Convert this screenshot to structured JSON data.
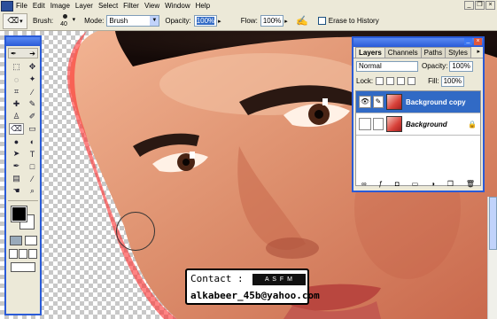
{
  "menu": [
    "File",
    "Edit",
    "Image",
    "Layer",
    "Select",
    "Filter",
    "View",
    "Window",
    "Help"
  ],
  "options": {
    "brush_label": "Brush:",
    "brush_size": "40",
    "mode_label": "Mode:",
    "mode_value": "Brush",
    "opacity_label": "Opacity:",
    "opacity_value": "100%",
    "flow_label": "Flow:",
    "flow_value": "100%",
    "erase_history_label": "Erase to History"
  },
  "layers": {
    "tabs": [
      "Layers",
      "Channels",
      "Paths",
      "Styles"
    ],
    "blend_mode": "Normal",
    "opacity_label": "Opacity:",
    "opacity_value": "100%",
    "lock_label": "Lock:",
    "fill_label": "Fill:",
    "fill_value": "100%",
    "items": [
      {
        "name": "Background copy",
        "selected": true
      },
      {
        "name": "Background",
        "selected": false
      }
    ]
  },
  "contact": {
    "label": "Contact :",
    "email": "alkabeer_45b@yahoo.com",
    "signature": "A S F M"
  },
  "colors": {
    "selection": "#316ac5",
    "title_bar": "#2a5bd7"
  }
}
